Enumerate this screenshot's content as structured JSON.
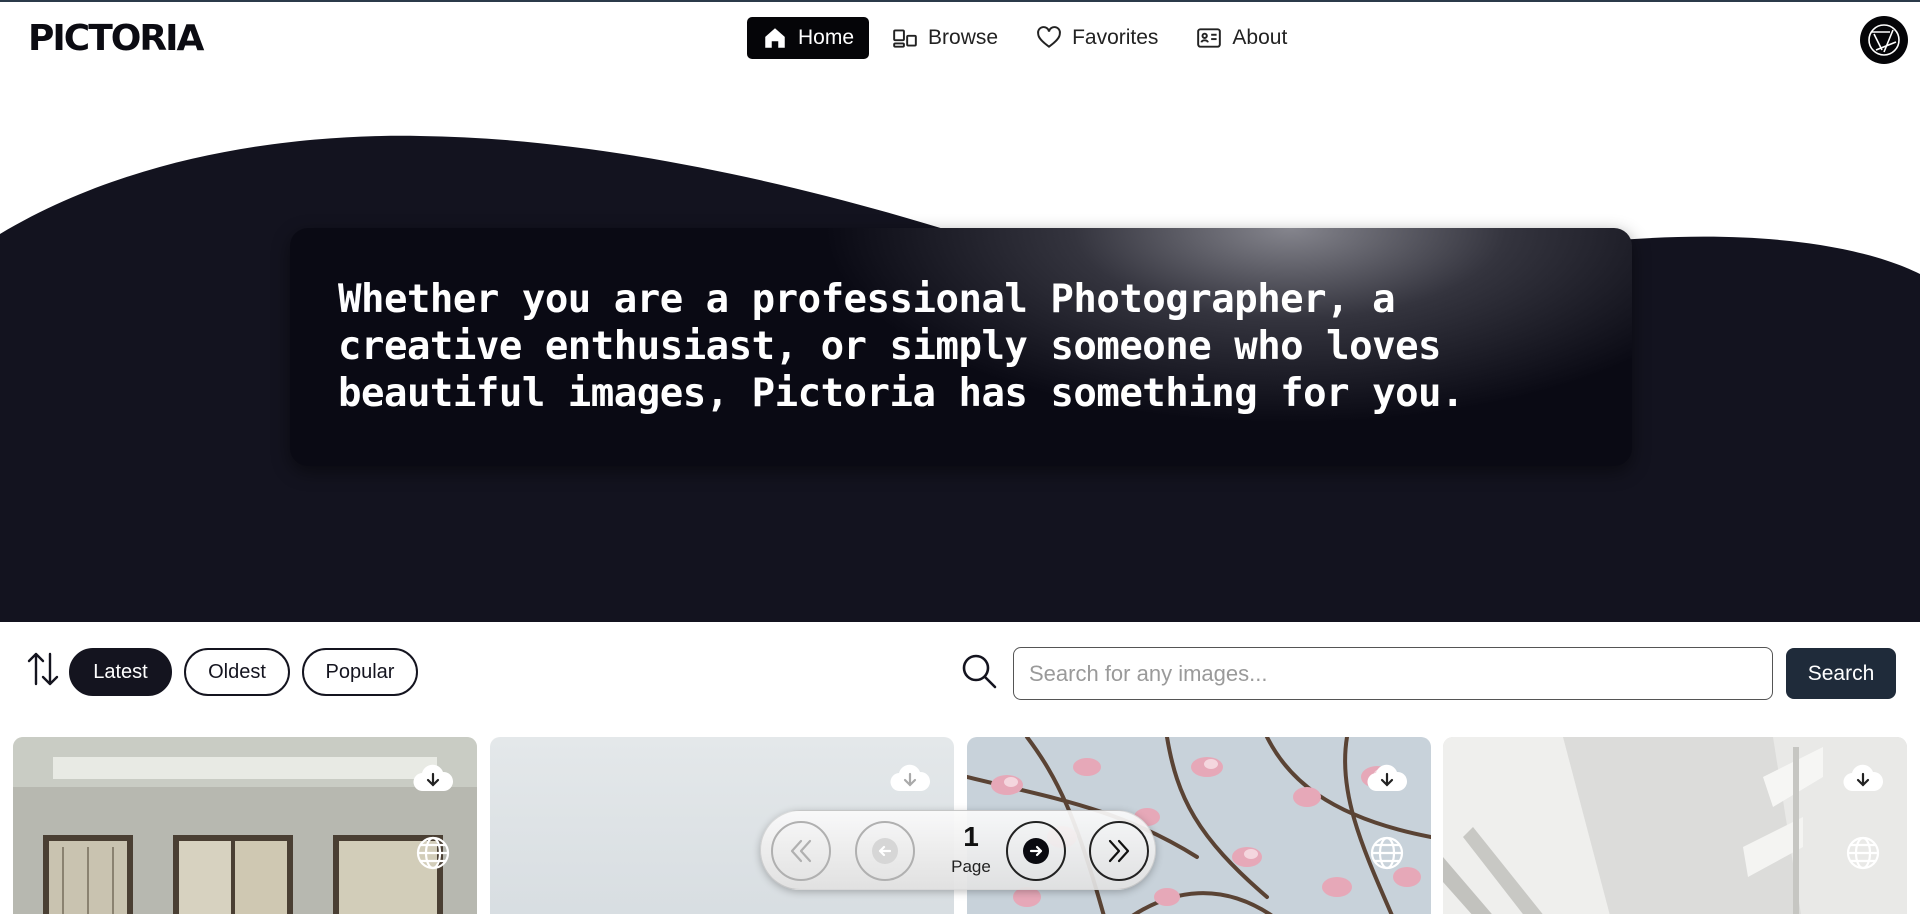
{
  "header": {
    "logo": "PICTORIA",
    "nav": [
      {
        "label": "Home",
        "icon": "home-icon",
        "active": true
      },
      {
        "label": "Browse",
        "icon": "browse-icon",
        "active": false
      },
      {
        "label": "Favorites",
        "icon": "heart-icon",
        "active": false
      },
      {
        "label": "About",
        "icon": "id-card-icon",
        "active": false
      }
    ],
    "avatar_icon": "aperture-logo-icon"
  },
  "hero": {
    "text": "Whether you are a professional Photographer, a creative enthusiast, or simply someone who loves beautiful images, Pictoria has something for you."
  },
  "toolbar": {
    "sort_icon": "sort-arrows-icon",
    "filters": [
      {
        "label": "Latest",
        "active": true
      },
      {
        "label": "Oldest",
        "active": false
      },
      {
        "label": "Popular",
        "active": false
      }
    ],
    "search_placeholder": "Search for any images...",
    "search_button": "Search"
  },
  "gallery": {
    "cards": [
      {
        "subject": "room with windows",
        "icons": [
          "cloud-download-icon",
          "globe-icon"
        ]
      },
      {
        "subject": "pale sky",
        "icons": [
          "cloud-download-icon"
        ]
      },
      {
        "subject": "pink magnolia blossoms",
        "icons": [
          "cloud-download-icon",
          "globe-icon"
        ]
      },
      {
        "subject": "white architecture",
        "icons": [
          "cloud-download-icon",
          "globe-icon"
        ]
      }
    ]
  },
  "pagination": {
    "page": "1",
    "label": "Page"
  },
  "colors": {
    "hero_bg": "#13131f",
    "primary_dark": "#050508",
    "search_button": "#1f2b3a"
  }
}
